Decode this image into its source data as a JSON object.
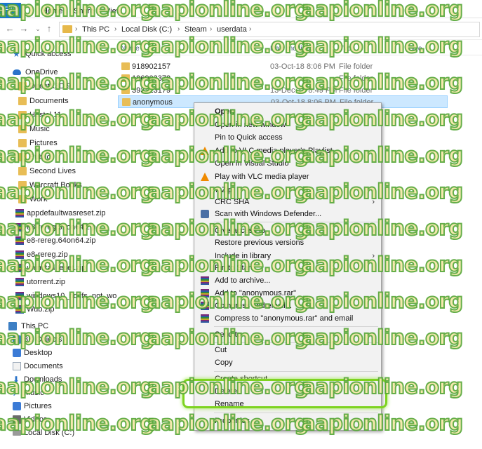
{
  "window": {
    "title": "anonymous"
  },
  "ribbon": {
    "tabs": [
      "File",
      "Home",
      "Share",
      "View"
    ]
  },
  "address_bar": {
    "crumbs": [
      "This PC",
      "Local Disk (C:)",
      "Steam",
      "userdata"
    ]
  },
  "columns": {
    "name": "Name",
    "date": "Date modified",
    "type": "Type",
    "size": "Size"
  },
  "nav_pane": {
    "items": [
      {
        "label": "Quick access",
        "icon": "star-icon"
      },
      {
        "label": "OneDrive",
        "icon": "cloud-icon"
      },
      {
        "label": "DirectX3D 9",
        "icon": "folder-icon"
      },
      {
        "label": "Documents",
        "icon": "folder-icon"
      },
      {
        "label": "Hostel 11",
        "icon": "folder-icon"
      },
      {
        "label": "Music",
        "icon": "folder-icon"
      },
      {
        "label": "Pictures",
        "icon": "folder-icon"
      },
      {
        "label": "Public",
        "icon": "folder-icon"
      },
      {
        "label": "Second Lives",
        "icon": "folder-icon"
      },
      {
        "label": "Warcraft Books",
        "icon": "folder-icon"
      },
      {
        "label": "Work",
        "icon": "folder-icon"
      },
      {
        "label": "appdefaultwasreset.zip",
        "icon": "zip-icon"
      },
      {
        "label": "e8-rereg.32on64.zip",
        "icon": "zip-icon"
      },
      {
        "label": "e8-rereg.64on64.zip",
        "icon": "zip-icon"
      },
      {
        "label": "e8-rereg.zip",
        "icon": "zip-icon"
      },
      {
        "label": "uninstall_eset.zip",
        "icon": "zip-icon"
      },
      {
        "label": "utorrent.zip",
        "icon": "zip-icon"
      },
      {
        "label": "windows10_notifs_not_wo",
        "icon": "zip-icon"
      },
      {
        "label": "Wub.zip",
        "icon": "zip-icon"
      },
      {
        "label": "This PC",
        "icon": "pc-icon"
      },
      {
        "label": "3D Objects",
        "icon": "folder-icon"
      },
      {
        "label": "Desktop",
        "icon": "folder-icon"
      },
      {
        "label": "Documents",
        "icon": "document-icon"
      },
      {
        "label": "Downloads",
        "icon": "download-icon"
      },
      {
        "label": "Music",
        "icon": "music-icon"
      },
      {
        "label": "Pictures",
        "icon": "folder-icon"
      },
      {
        "label": "Videos",
        "icon": "video-icon"
      },
      {
        "label": "Local Disk (C:)",
        "icon": "drive-icon"
      }
    ]
  },
  "files": [
    {
      "name": "918902157",
      "date": "03-Oct-18 8:06 PM",
      "type": "File folder"
    },
    {
      "name": "196903378",
      "date": "",
      "type": "File folder"
    },
    {
      "name": "393123179",
      "date": "13-Dec-18 8:49 PM",
      "type": "File folder"
    },
    {
      "name": "anonymous",
      "date": "03-Oct-18 8:06 PM",
      "type": "File folder"
    }
  ],
  "context_menu": {
    "items": [
      {
        "label": "Open",
        "bold": true,
        "icon": "",
        "submenu": false
      },
      {
        "label": "Open in new window",
        "icon": "",
        "submenu": false
      },
      {
        "label": "Pin to Quick access",
        "icon": "",
        "submenu": false
      },
      {
        "label": "Add to VLC media player's Playlist",
        "icon": "vlc-icon",
        "submenu": false
      },
      {
        "label": "Open in Visual Studio",
        "icon": "",
        "submenu": false
      },
      {
        "label": "Play with VLC media player",
        "icon": "vlc-icon",
        "submenu": false
      },
      {
        "label": "7-Zip",
        "icon": "",
        "submenu": true
      },
      {
        "label": "CRC SHA",
        "icon": "",
        "submenu": true
      },
      {
        "label": "Scan with Windows Defender...",
        "icon": "defender-icon",
        "submenu": false
      },
      {
        "label": "Give access to",
        "icon": "",
        "submenu": true
      },
      {
        "label": "Restore previous versions",
        "icon": "",
        "submenu": false
      },
      {
        "label": "Include in library",
        "icon": "",
        "submenu": true
      },
      {
        "label": "Pin to Start",
        "icon": "",
        "submenu": false
      },
      {
        "label": "Add to archive...",
        "icon": "winrar-icon",
        "submenu": false
      },
      {
        "label": "Add to \"anonymous.rar\"",
        "icon": "winrar-icon",
        "submenu": false
      },
      {
        "label": "Compress and email...",
        "icon": "winrar-icon",
        "submenu": false
      },
      {
        "label": "Compress to \"anonymous.rar\" and email",
        "icon": "winrar-icon",
        "submenu": false
      },
      {
        "label": "Send to",
        "icon": "",
        "submenu": true
      },
      {
        "label": "Cut",
        "icon": "",
        "submenu": false
      },
      {
        "label": "Copy",
        "icon": "",
        "submenu": false
      },
      {
        "label": "Create shortcut",
        "icon": "",
        "submenu": false
      },
      {
        "label": "Delete",
        "icon": "",
        "submenu": false
      },
      {
        "label": "Rename",
        "icon": "",
        "submenu": false
      },
      {
        "label": "Properties",
        "icon": "",
        "submenu": false
      }
    ]
  },
  "watermark": {
    "text": "aapionline.org"
  },
  "colors": {
    "accent": "#1979ca",
    "selection": "#cce8ff",
    "highlight_box": "#7ed321",
    "folder": "#e8bd56"
  }
}
